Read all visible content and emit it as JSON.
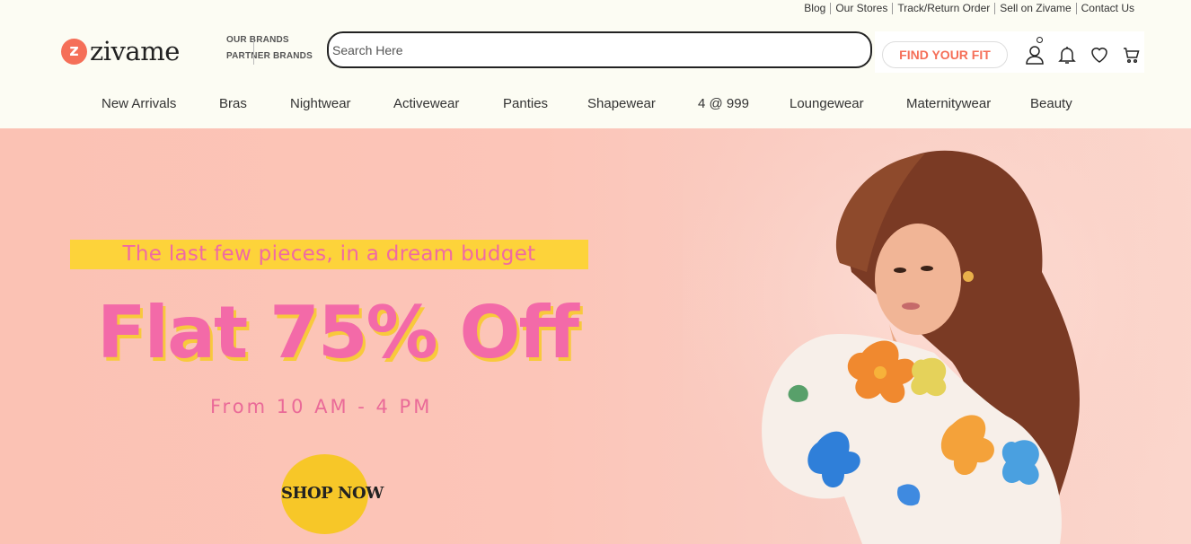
{
  "top_links": [
    "Blog",
    "Our Stores",
    "Track/Return Order",
    "Sell on Zivame",
    "Contact Us"
  ],
  "logo": {
    "text": "zivame",
    "mark": "z",
    "icon": "zivame-logo"
  },
  "brands": {
    "our": "OUR BRANDS",
    "partner": "PARTNER BRANDS"
  },
  "search": {
    "placeholder": "Search Here",
    "value": ""
  },
  "find_fit": "FIND YOUR FIT",
  "header_icons": [
    "user-icon",
    "bell-icon",
    "heart-icon",
    "cart-icon"
  ],
  "nav": [
    "New Arrivals",
    "Bras",
    "Nightwear",
    "Activewear",
    "Panties",
    "Shapewear",
    "4 @ 999",
    "Loungewear",
    "Maternitywear",
    "Beauty"
  ],
  "hero": {
    "tagline": "The last few pieces, in a dream budget",
    "headline": "Flat 75% Off",
    "time": "From 10 AM - 4 PM",
    "cta": "SHOP NOW"
  },
  "colors": {
    "brand": "#f56f58",
    "hero_bg": "#fcc5b8",
    "tagline_bg": "#fdd33a",
    "headline": "#f36aa8",
    "cta_bg": "#f7c728"
  }
}
